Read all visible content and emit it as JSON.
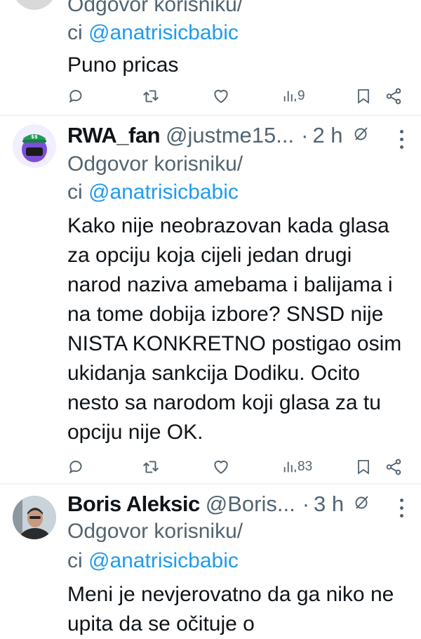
{
  "tweets": [
    {
      "name": "",
      "handle": "",
      "time": "",
      "reply_prefix": "Odgovor korisniku/",
      "reply_cc": "ci",
      "mention": "@anatrisicbabic",
      "text": "Puno pricas",
      "views": "9"
    },
    {
      "name": "RWA_fan",
      "handle": "@justme15...",
      "time": "2 h",
      "reply_prefix": "Odgovor korisniku/",
      "reply_cc": "ci",
      "mention": "@anatrisicbabic",
      "text": "Kako nije neobrazovan kada glasa za opciju koja cijeli jedan drugi narod naziva amebama i balijama i na tome dobija izbore? SNSD nije NISTA KONKRETNO postigao osim ukidanja sankcija Dodiku. Ocito nesto sa narodom koji glasa za tu opciju nije OK.",
      "views": "83"
    },
    {
      "name": "Boris Aleksic",
      "handle": "@Boris...",
      "time": "3 h",
      "reply_prefix": "Odgovor korisniku/",
      "reply_cc": "ci",
      "mention": "@anatrisicbabic",
      "text": "Meni je nevjerovatno da ga niko ne upita da se očituje o"
    }
  ],
  "colors": {
    "accent": "#1d9bf0",
    "muted": "#536471",
    "text": "#0f1419",
    "divider": "#eff3f4"
  },
  "icons": [
    "reply-icon",
    "retweet-icon",
    "like-icon",
    "views-icon",
    "bookmark-icon",
    "share-icon",
    "grok-icon",
    "more-icon"
  ]
}
